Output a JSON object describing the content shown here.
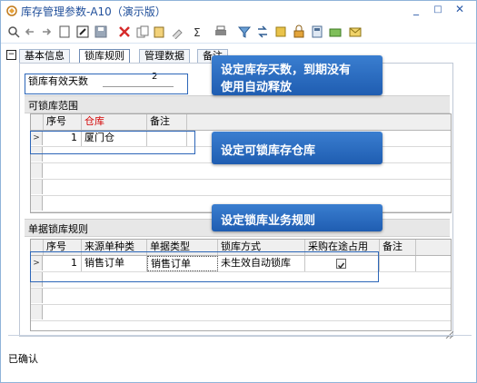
{
  "window": {
    "title": "库存管理参数-A10（演示版）",
    "controls": [
      "minimize-icon",
      "maximize-icon",
      "close-icon"
    ]
  },
  "toolbar": {
    "icons": [
      "preview-icon",
      "back-icon",
      "forward-icon",
      "new-icon",
      "edit-icon",
      "save-icon",
      "delete-icon",
      "copy-icon",
      "paste-icon",
      "clear-icon",
      "sort-icon",
      "print-icon",
      "filter-icon",
      "refresh-icon",
      "export-icon",
      "lock-icon",
      "calc-icon",
      "folder-icon",
      "mail-icon"
    ]
  },
  "tabs": [
    "基本信息",
    "锁库规则",
    "管理数据",
    "备注"
  ],
  "active_tab": "锁库规则",
  "lock_days": {
    "label": "锁库有效天数",
    "value": "2"
  },
  "range_section": {
    "title": "可锁库范围",
    "columns": [
      "序号",
      "仓库",
      "备注"
    ],
    "rows": [
      {
        "no": "1",
        "warehouse": "厦门仓",
        "remark": ""
      }
    ]
  },
  "rule_section": {
    "title": "单据锁库规则",
    "columns": [
      "序号",
      "来源单种类",
      "单据类型",
      "锁库方式",
      "采购在途占用",
      "备注"
    ],
    "rows": [
      {
        "no": "1",
        "source": "销售订单",
        "doctype": "销售订单",
        "method": "未生效自动锁库",
        "purchase_in_transit": true,
        "remark": ""
      }
    ]
  },
  "callouts": {
    "c1_line1": "设定库存天数，到期没有",
    "c1_line2": "使用自动释放",
    "c2": "设定可锁库存仓库",
    "c3": "设定锁库业务规则"
  },
  "status": "已确认",
  "colors": {
    "title_text": "#1f4e9a",
    "callout_bg": "#2f6fc2",
    "highlight_border": "#2c66b8",
    "required_text": "#d40000"
  }
}
